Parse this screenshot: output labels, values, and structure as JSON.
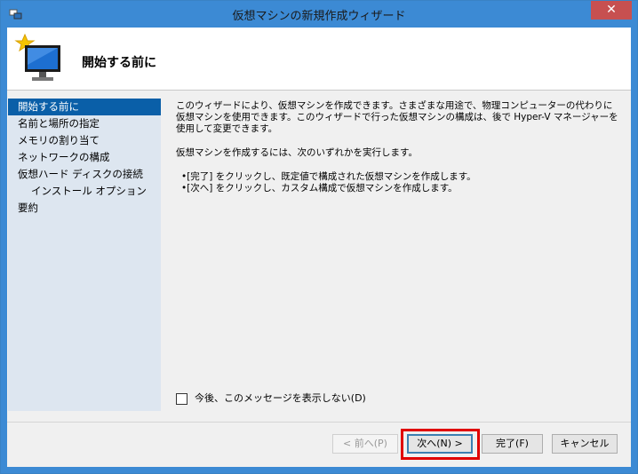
{
  "window": {
    "title": "仮想マシンの新規作成ウィザード",
    "close_label": "✕"
  },
  "header": {
    "title": "開始する前に"
  },
  "nav": {
    "items": [
      {
        "label": "開始する前に"
      },
      {
        "label": "名前と場所の指定"
      },
      {
        "label": "メモリの割り当て"
      },
      {
        "label": "ネットワークの構成"
      },
      {
        "label": "仮想ハード ディスクの接続"
      },
      {
        "label": "インストール オプション"
      },
      {
        "label": "要約"
      }
    ]
  },
  "content": {
    "para1": "このウィザードにより、仮想マシンを作成できます。さまざまな用途で、物理コンピューターの代わりに仮想マシンを使用できます。このウィザードで行った仮想マシンの構成は、後で Hyper-V マネージャーを使用して変更できます。",
    "para2": "仮想マシンを作成するには、次のいずれかを実行します。",
    "bullet1": "•[完了] をクリックし、既定値で構成された仮想マシンを作成します。",
    "bullet2": "•[次へ] をクリックし、カスタム構成で仮想マシンを作成します。"
  },
  "checkbox": {
    "label": "今後、このメッセージを表示しない(D)",
    "checked": false
  },
  "buttons": {
    "back": "< 前へ(P)",
    "next": "次へ(N) >",
    "finish": "完了(F)",
    "cancel": "キャンセル"
  },
  "colors": {
    "titlebar": "#3c8ad4",
    "close": "#c75050",
    "nav_bg": "#dde6f0",
    "nav_selected": "#0a5fa8",
    "highlight": "#e00000"
  }
}
